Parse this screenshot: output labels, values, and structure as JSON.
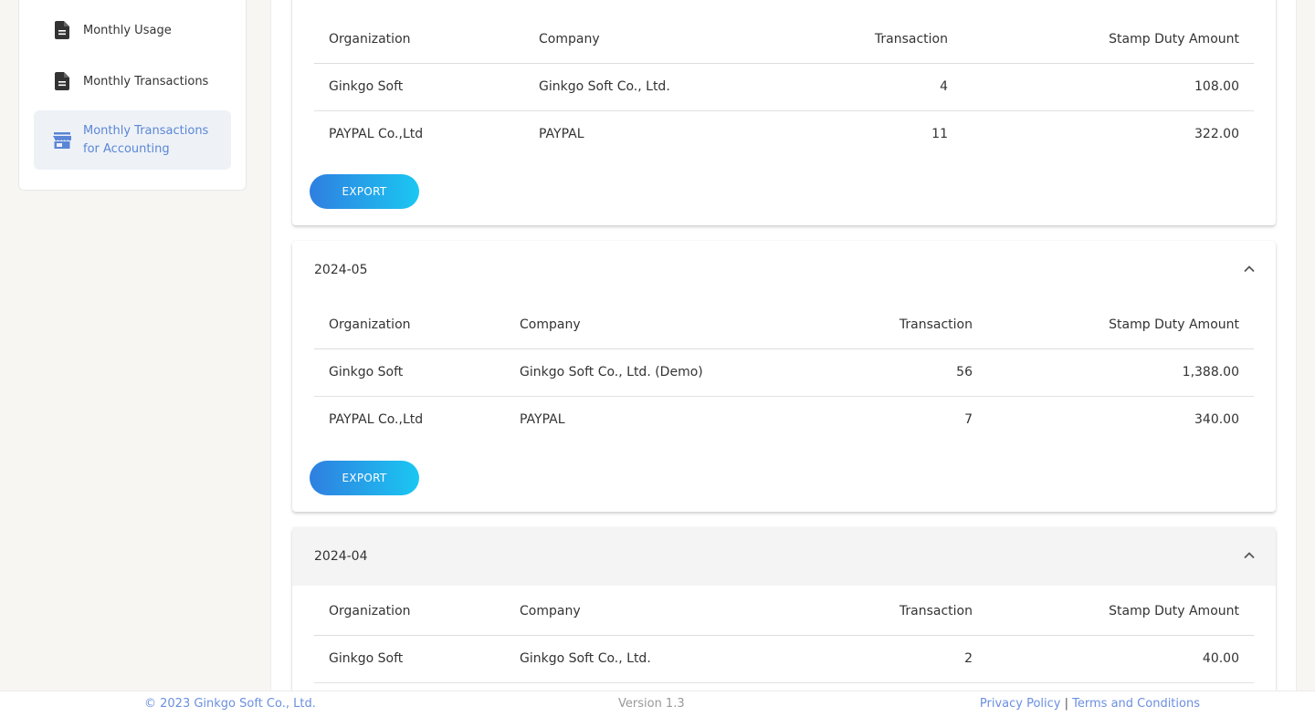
{
  "sidebar": {
    "items": [
      {
        "label": "Monthly Usage",
        "icon": "document-icon"
      },
      {
        "label": "Monthly Transactions",
        "icon": "document-icon"
      },
      {
        "label": "Monthly Transactions for Accounting",
        "line1": "Monthly Transactions",
        "line2": "for Accounting",
        "icon": "store-icon",
        "active": true
      }
    ]
  },
  "columns": {
    "organization": "Organization",
    "company": "Company",
    "transaction": "Transaction",
    "amount": "Stamp Duty Amount"
  },
  "export_label": "EXPORT",
  "cards": [
    {
      "rows": [
        {
          "organization": "Ginkgo Soft",
          "company": "Ginkgo Soft Co., Ltd.",
          "transaction": "4",
          "amount": "108.00"
        },
        {
          "organization": "PAYPAL Co.,Ltd",
          "company": "PAYPAL",
          "transaction": "11",
          "amount": "322.00"
        }
      ]
    },
    {
      "month": "2024-05",
      "rows": [
        {
          "organization": "Ginkgo Soft",
          "company": "Ginkgo Soft Co., Ltd. (Demo)",
          "transaction": "56",
          "amount": "1,388.00"
        },
        {
          "organization": "PAYPAL Co.,Ltd",
          "company": "PAYPAL",
          "transaction": "7",
          "amount": "340.00"
        }
      ]
    },
    {
      "month": "2024-04",
      "rows": [
        {
          "organization": "Ginkgo Soft",
          "company": "Ginkgo Soft Co., Ltd.",
          "transaction": "2",
          "amount": "40.00"
        }
      ]
    }
  ],
  "footer": {
    "copyright": "© 2023 Ginkgo Soft Co., Ltd.",
    "version": "Version 1.3",
    "privacy": "Privacy Policy",
    "separator": "|",
    "terms": "Terms and Conditions"
  },
  "colors": {
    "accent": "#5b86d6",
    "export_start": "#2f7fe0",
    "export_end": "#1bc7f2"
  }
}
